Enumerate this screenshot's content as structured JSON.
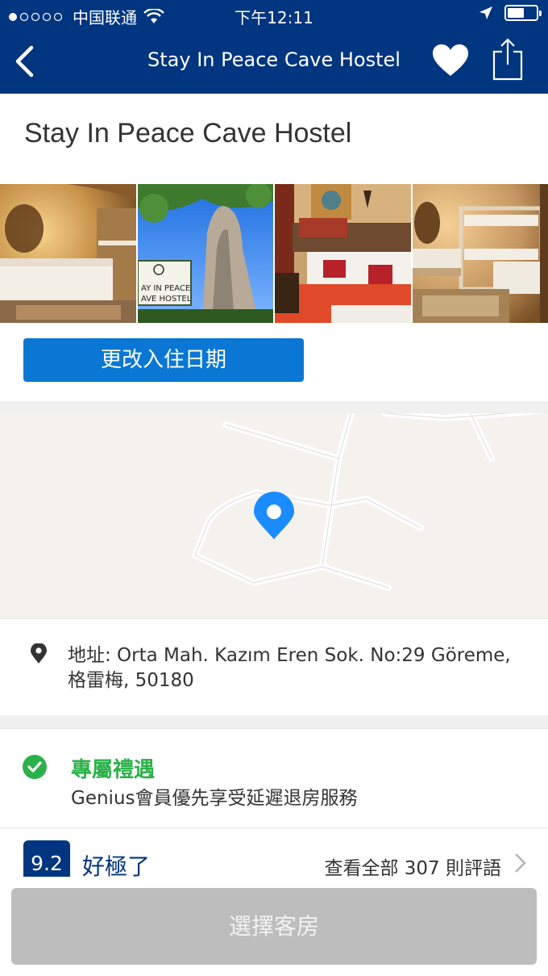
{
  "status_bar": {
    "carrier": "中国联通",
    "time": "下午12:11",
    "battery_level": 0.6
  },
  "nav": {
    "title": "Stay In Peace Cave Hostel",
    "icons": [
      "back-chevron-icon",
      "heart-icon",
      "share-icon"
    ]
  },
  "hotel": {
    "name": "Stay In Peace Cave Hostel",
    "photo_sign_text": "AY IN PEACE\nAVE HOSTEL"
  },
  "actions": {
    "change_dates_label": "更改入住日期",
    "select_room_label": "選擇客房"
  },
  "address": {
    "text": "地址: Orta Mah. Kazım Eren Sok. No:29 Göreme, 格雷梅, 50180"
  },
  "perk": {
    "title": "專屬禮遇",
    "description": "Genius會員優先享受延遲退房服務"
  },
  "reviews": {
    "score": "9.2",
    "score_word": "好極了",
    "link_text": "查看全部 307 則評語"
  },
  "colors": {
    "brand_blue": "#003580",
    "button_blue": "#0a77d5",
    "pin_blue": "#1a8cff",
    "perk_green": "#2bb14a",
    "disabled_gray": "#bdbdbd"
  }
}
